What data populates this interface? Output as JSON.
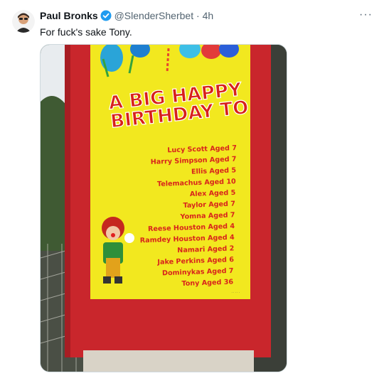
{
  "tweet": {
    "author_name": "Paul Bronks",
    "handle": "@SlenderSherbet",
    "separator": "·",
    "time": "4h",
    "text": "For fuck's sake Tony.",
    "more_icon": "more-horizontal-icon",
    "verified_icon": "verified-badge-icon"
  },
  "media": {
    "heading_line1": "A BIG HAPPY",
    "heading_line2": "BIRTHDAY TO",
    "names": [
      "Lucy Scott Aged 7",
      "Harry Simpson Aged 7",
      "Ellis Aged 5",
      "Telemachus Aged 10",
      "Alex Aged 5",
      "Taylor Aged 7",
      "Yomna Aged 7",
      "Reese Houston Aged 4",
      "Ramdey Houston Aged 4",
      "Namari Aged 2",
      "Jake Perkins Aged 6",
      "Dominykas Aged 7",
      "Tony Aged 36"
    ],
    "colors": {
      "sign_yellow": "#f2e81f",
      "frame_red": "#c9262c",
      "name_red": "#d8241c",
      "heading_red": "#d8201a",
      "heading_blue": "#2f5fd0"
    }
  }
}
